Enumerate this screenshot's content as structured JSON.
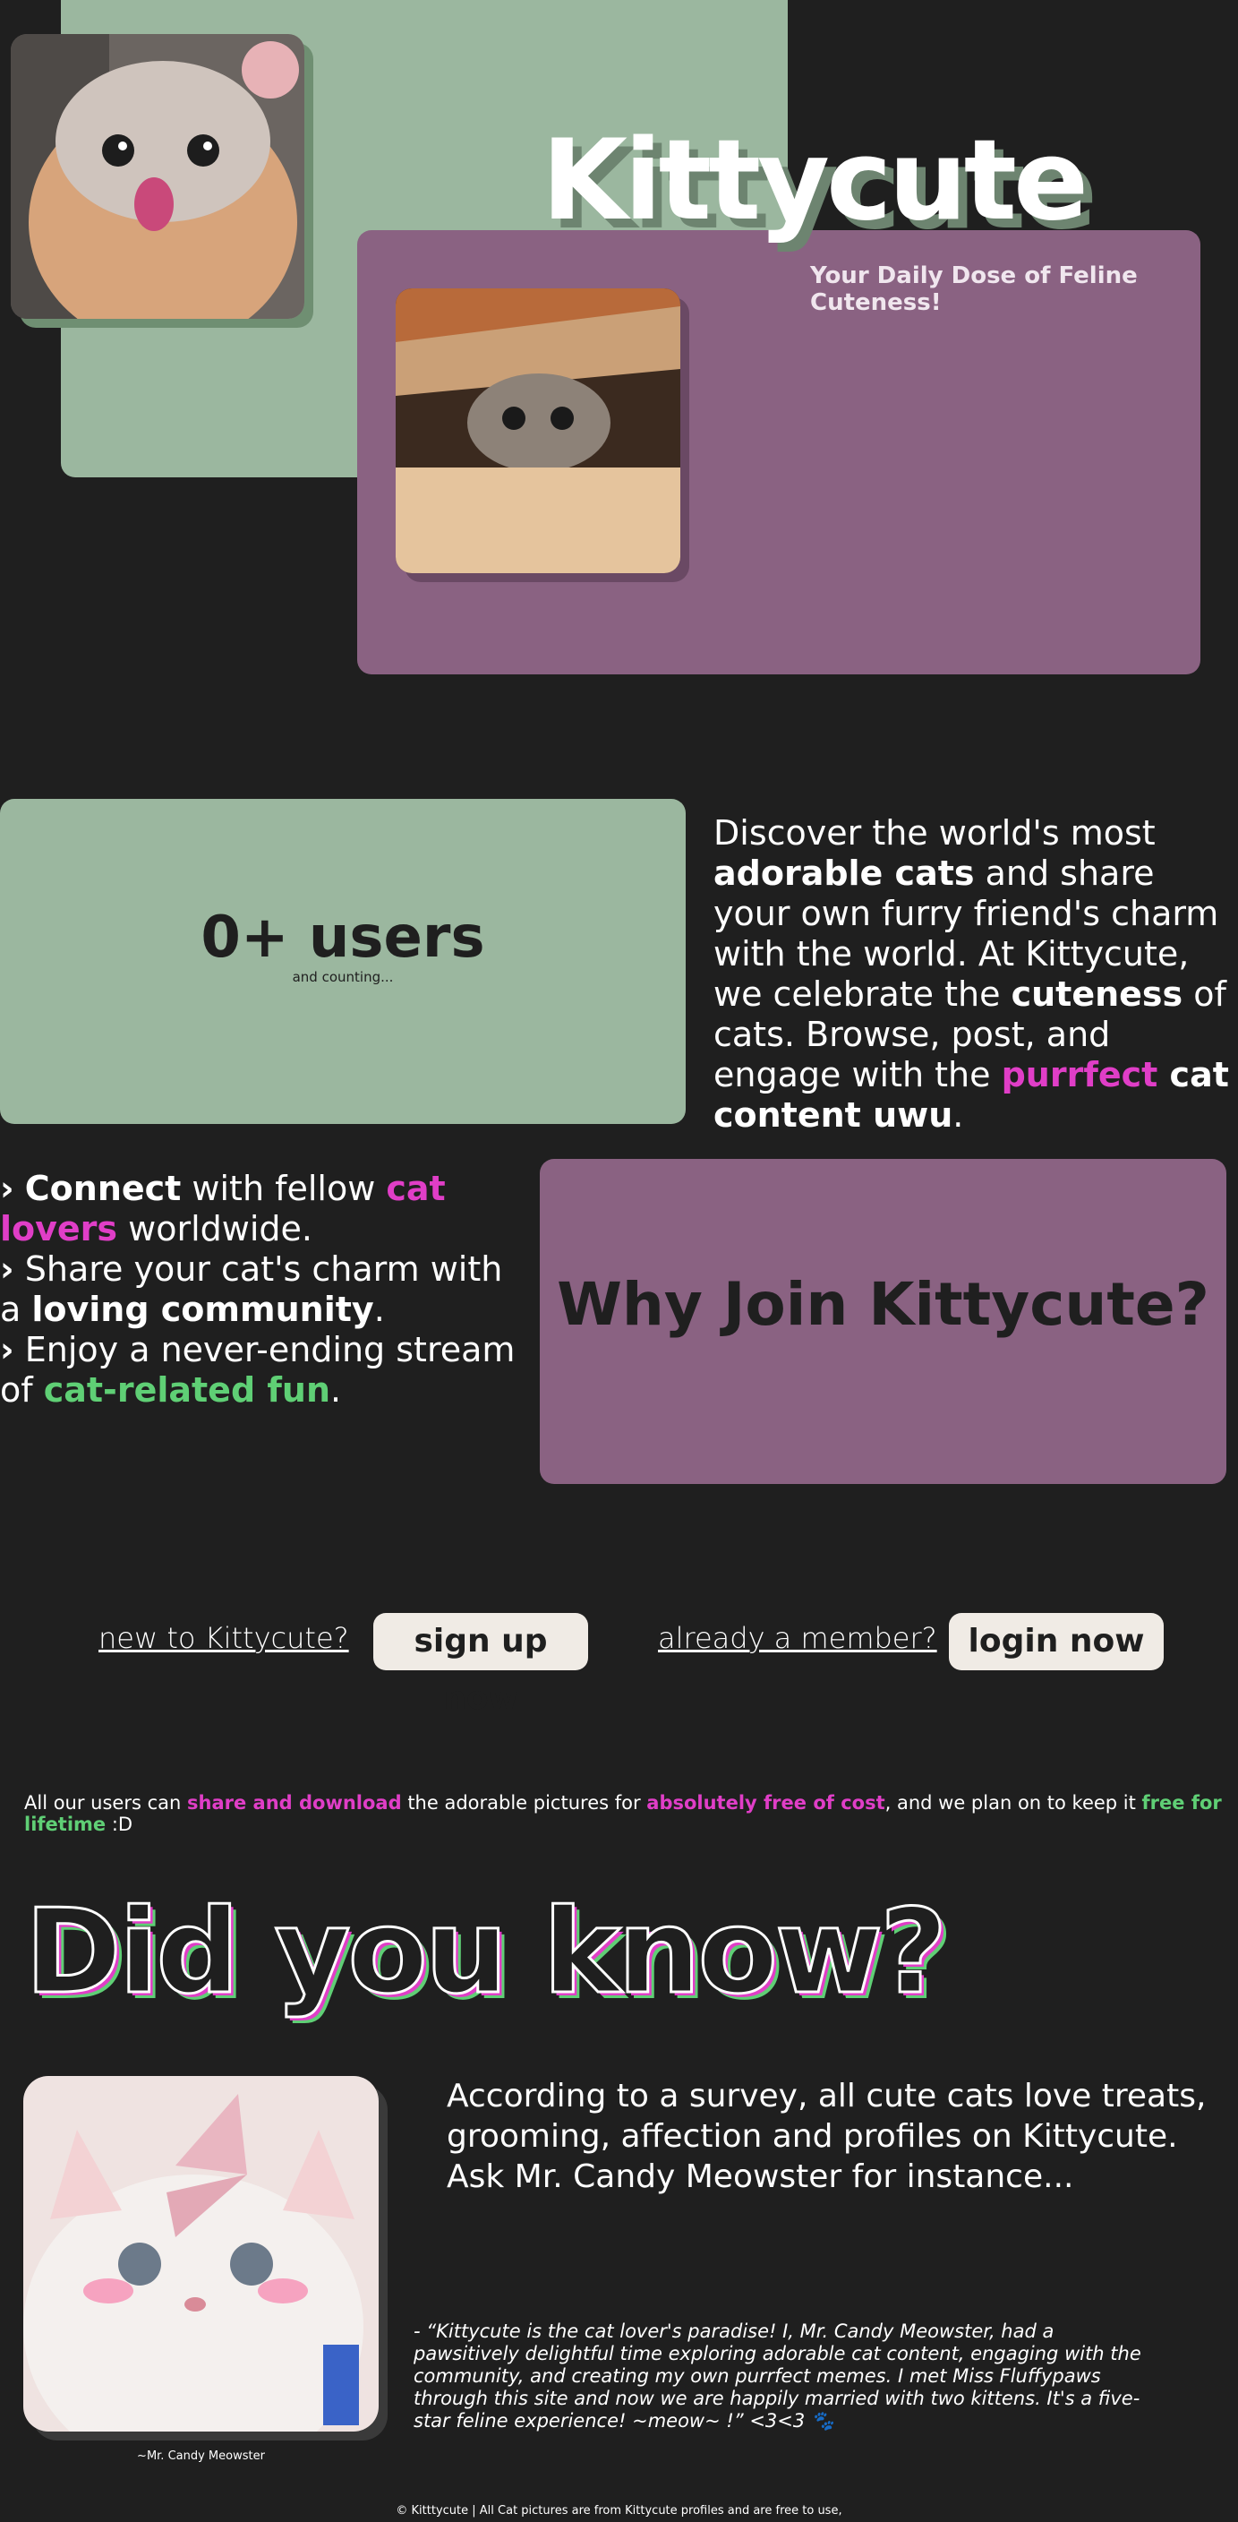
{
  "hero": {
    "title": "Kittycute",
    "tagline": "Your Daily Dose of Feline Cuteness!",
    "images": [
      "cat-licking-lips",
      "cat-in-box"
    ]
  },
  "users": {
    "count": "0+ users",
    "sub": "and counting..."
  },
  "discover": {
    "p1": "Discover the world's most ",
    "b1": "adorable cats",
    "p2": " and share your own furry friend's charm with the world. At Kittycute, we celebrate the ",
    "b2": "cuteness",
    "p3": " of cats. Browse, post, and engage with the ",
    "pink": "purrfect",
    "b3": " cat content uwu",
    "p4": "."
  },
  "benefits": [
    {
      "bullet": "›",
      "bold": "Connect",
      "text": " with fellow ",
      "pink": "cat lovers",
      "tail": " worldwide."
    },
    {
      "bullet": "›",
      "text": " Share your cat's charm with a ",
      "bold": "loving community",
      "tail": "."
    },
    {
      "bullet": "›",
      "text": " Enjoy a never-ending stream of ",
      "green": "cat-related fun",
      "tail": "."
    }
  ],
  "why": {
    "title": "Why Join Kittycute?"
  },
  "cta": {
    "new_text": "new to Kittycute?",
    "signup_label": "sign up now",
    "member_text": "already a member?",
    "login_label": "login now"
  },
  "free": {
    "p1": "All our users can ",
    "pink1": "share and download",
    "p2": " the adorable pictures for ",
    "pink2": "absolutely free of cost",
    "p3": ", and we plan on to keep it ",
    "green": "free for lifetime",
    "p4": " :D"
  },
  "dyk": {
    "title": "Did you know?",
    "image": "white-kitten-with-butterfly",
    "caption": "~Mr. Candy Meowster",
    "survey": "According to a survey, all cute cats love treats, grooming, affection and profiles on Kittycute. Ask  Mr. Candy Meowster for instance...",
    "quote": " - “Kittycute is the cat lover's paradise! I, Mr. Candy Meowster, had a pawsitively delightful time exploring adorable cat content, engaging with the community, and creating my own purrfect memes. I met Miss Fluffypaws through this site and now we are happily married with two kittens. It's a five-star feline experience! ~meow~ !” <3<3 🐾"
  },
  "footer": {
    "text": "© Kitttycute | All Cat pictures are from Kittycute profiles and are free to use,"
  },
  "colors": {
    "background": "#1f1f1f",
    "green": "#9bb79f",
    "purple": "#8a6282",
    "pink_accent": "#e03ec7",
    "green_accent": "#5fcf75"
  }
}
